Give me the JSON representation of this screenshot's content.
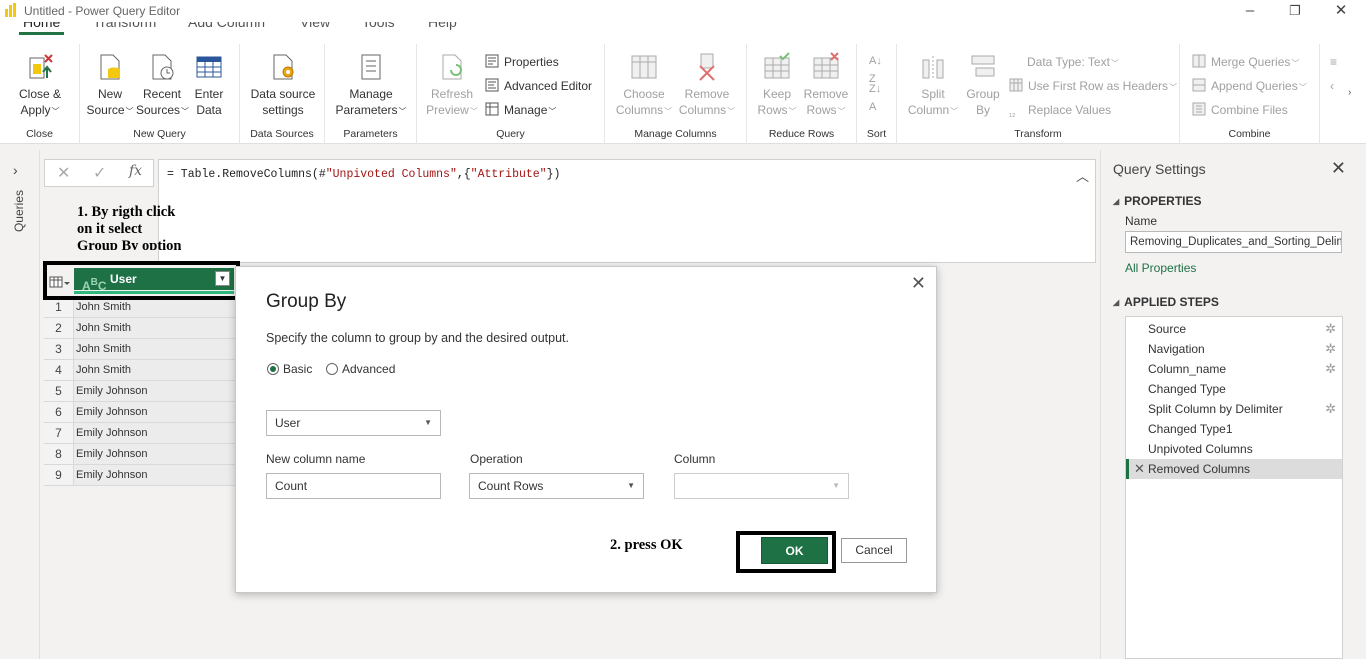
{
  "window": {
    "title": "Untitled - Power Query Editor"
  },
  "menu_tabs": [
    "Home",
    "Transform",
    "Add Column",
    "View",
    "Tools",
    "Help"
  ],
  "ribbon": {
    "close": {
      "btn": "Close &",
      "btn2": "Apply",
      "group": "Close"
    },
    "new_query": {
      "new_source": "New",
      "new_source2": "Source",
      "recent": "Recent",
      "recent2": "Sources",
      "enter": "Enter",
      "enter2": "Data",
      "group": "New Query"
    },
    "data_sources": {
      "btn": "Data source",
      "btn2": "settings",
      "group": "Data Sources"
    },
    "parameters": {
      "btn": "Manage",
      "btn2": "Parameters",
      "group": "Parameters"
    },
    "query": {
      "refresh": "Refresh",
      "refresh2": "Preview",
      "properties": "Properties",
      "advanced": "Advanced Editor",
      "manage": "Manage",
      "group": "Query"
    },
    "manage_columns": {
      "choose": "Choose",
      "choose2": "Columns",
      "remove": "Remove",
      "remove2": "Columns",
      "group": "Manage Columns"
    },
    "reduce_rows": {
      "keep": "Keep",
      "keep2": "Rows",
      "remove": "Remove",
      "remove2": "Rows",
      "group": "Reduce Rows"
    },
    "sort": {
      "group": "Sort"
    },
    "transform": {
      "split": "Split",
      "split2": "Column",
      "groupby": "Group",
      "groupby2": "By",
      "datatype": "Data Type: Text",
      "firstrow": "Use First Row as Headers",
      "replace": "Replace Values",
      "group": "Transform"
    },
    "combine": {
      "merge": "Merge Queries",
      "append": "Append Queries",
      "combine": "Combine Files",
      "group": "Combine"
    }
  },
  "queries_pane": {
    "label": "Queries"
  },
  "formula_bar": {
    "fx": "fx",
    "prefix": "= Table.RemoveColumns(#",
    "str1": "\"Unpivoted Columns\"",
    "mid": ",{",
    "str2": "\"Attribute\"",
    "suffix": "})"
  },
  "annotations": {
    "step1_line1": "1. By rigth click",
    "step1_line2": "on it select",
    "step1_line3": "Group By option",
    "step2": "2. press OK"
  },
  "grid": {
    "column": "User",
    "rows": [
      {
        "n": "1",
        "v": "John Smith"
      },
      {
        "n": "2",
        "v": "John Smith"
      },
      {
        "n": "3",
        "v": "John Smith"
      },
      {
        "n": "4",
        "v": "John Smith"
      },
      {
        "n": "5",
        "v": "Emily Johnson"
      },
      {
        "n": "6",
        "v": "Emily Johnson"
      },
      {
        "n": "7",
        "v": "Emily Johnson"
      },
      {
        "n": "8",
        "v": "Emily Johnson"
      },
      {
        "n": "9",
        "v": "Emily Johnson"
      }
    ]
  },
  "dialog": {
    "title": "Group By",
    "description": "Specify the column to group by and the desired output.",
    "basic": "Basic",
    "advanced": "Advanced",
    "group_column": "User",
    "new_column_label": "New column name",
    "new_column_value": "Count",
    "operation_label": "Operation",
    "operation_value": "Count Rows",
    "column_label": "Column",
    "column_value": "",
    "ok": "OK",
    "cancel": "Cancel"
  },
  "settings": {
    "title": "Query Settings",
    "properties": "PROPERTIES",
    "name_label": "Name",
    "name_value": "Removing_Duplicates_and_Sorting_Delim",
    "all_properties": "All Properties",
    "applied_steps": "APPLIED STEPS",
    "steps": [
      {
        "label": "Source",
        "gear": true
      },
      {
        "label": "Navigation",
        "gear": true
      },
      {
        "label": "Column_name",
        "gear": true
      },
      {
        "label": "Changed Type",
        "gear": false
      },
      {
        "label": "Split Column by Delimiter",
        "gear": true
      },
      {
        "label": "Changed Type1",
        "gear": false
      },
      {
        "label": "Unpivoted Columns",
        "gear": false
      },
      {
        "label": "Removed Columns",
        "gear": false,
        "selected": true
      }
    ]
  },
  "colors": {
    "accent": "#1e7145",
    "quality_bar": "#2eb67d"
  }
}
